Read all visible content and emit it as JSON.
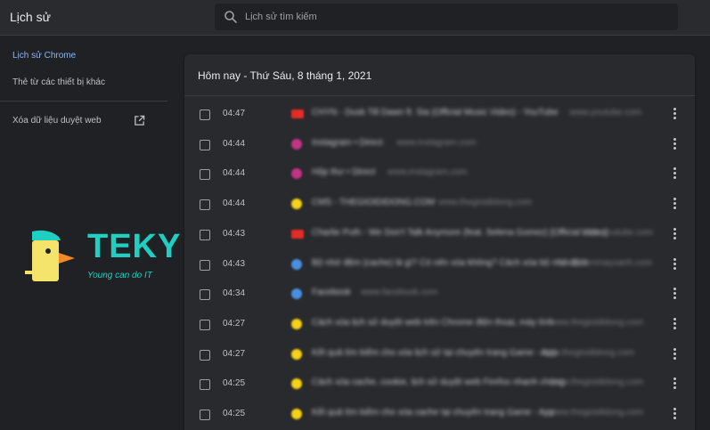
{
  "app": {
    "title": "Lịch sử"
  },
  "search": {
    "placeholder": "Lịch sử tìm kiếm",
    "icon": "search-icon"
  },
  "sidebar": {
    "items": [
      {
        "label": "Lịch sử Chrome",
        "active": true
      },
      {
        "label": "Thẻ từ các thiết bị khác",
        "active": false
      },
      {
        "label": "Xóa dữ liệu duyệt web",
        "active": false,
        "icon": "open-in-new-icon"
      }
    ]
  },
  "logo": {
    "word": "TEKY",
    "slogan": "Young can do IT"
  },
  "history": {
    "date_heading": "Hôm nay - Thứ Sáu, 8 tháng 1, 2021",
    "entries": [
      {
        "time": "04:47",
        "title": "CHYN - Dusk Till Dawn ft. Sia (Official Music Video) - YouTube",
        "domain": "www.youtube.com",
        "favicon_color": "#e52d27"
      },
      {
        "time": "04:44",
        "title": "Instagram • Direct",
        "domain": "www.instagram.com",
        "favicon_color": "#c13584"
      },
      {
        "time": "04:44",
        "title": "Hộp thư • Direct",
        "domain": "www.instagram.com",
        "favicon_color": "#c13584"
      },
      {
        "time": "04:44",
        "title": "CMS - THEGIOIDIDONG.COM",
        "domain": "www.thegioididong.com",
        "favicon_color": "#f7d117"
      },
      {
        "time": "04:43",
        "title": "Charlie Puth - We Don't Talk Anymore (feat. Selena Gomez) [Official Video]",
        "domain": "www.youtube.com",
        "favicon_color": "#e52d27"
      },
      {
        "time": "04:43",
        "title": "Bộ nhớ đệm (cache) là gì? Có nên xóa không? Cách xóa bộ nhớ đệm",
        "domain": "www.dienmayxanh.com",
        "favicon_color": "#4a90e2"
      },
      {
        "time": "04:34",
        "title": "Facebook",
        "domain": "www.facebook.com",
        "favicon_color": "#4a90e2"
      },
      {
        "time": "04:27",
        "title": "Cách xóa lịch sử duyệt web trên Chrome điện thoại, máy tính",
        "domain": "www.thegioididong.com",
        "favicon_color": "#f7d117"
      },
      {
        "time": "04:27",
        "title": "Kết quả tìm kiếm cho xóa lịch sử tại chuyên trang Game - App",
        "domain": "www.thegioididong.com",
        "favicon_color": "#f7d117"
      },
      {
        "time": "04:25",
        "title": "Cách xóa cache, cookie, lịch sử duyệt web Firefox nhanh chóng",
        "domain": "www.thegioididong.com",
        "favicon_color": "#f7d117"
      },
      {
        "time": "04:25",
        "title": "Kết quả tìm kiếm cho xóa cache tại chuyên trang Game - App",
        "domain": "www.thegioididong.com",
        "favicon_color": "#f7d117"
      }
    ]
  },
  "colors": {
    "background": "#202124",
    "card": "#292a2d",
    "accent": "#8ab4f8",
    "logo": "#1fd0c2"
  }
}
